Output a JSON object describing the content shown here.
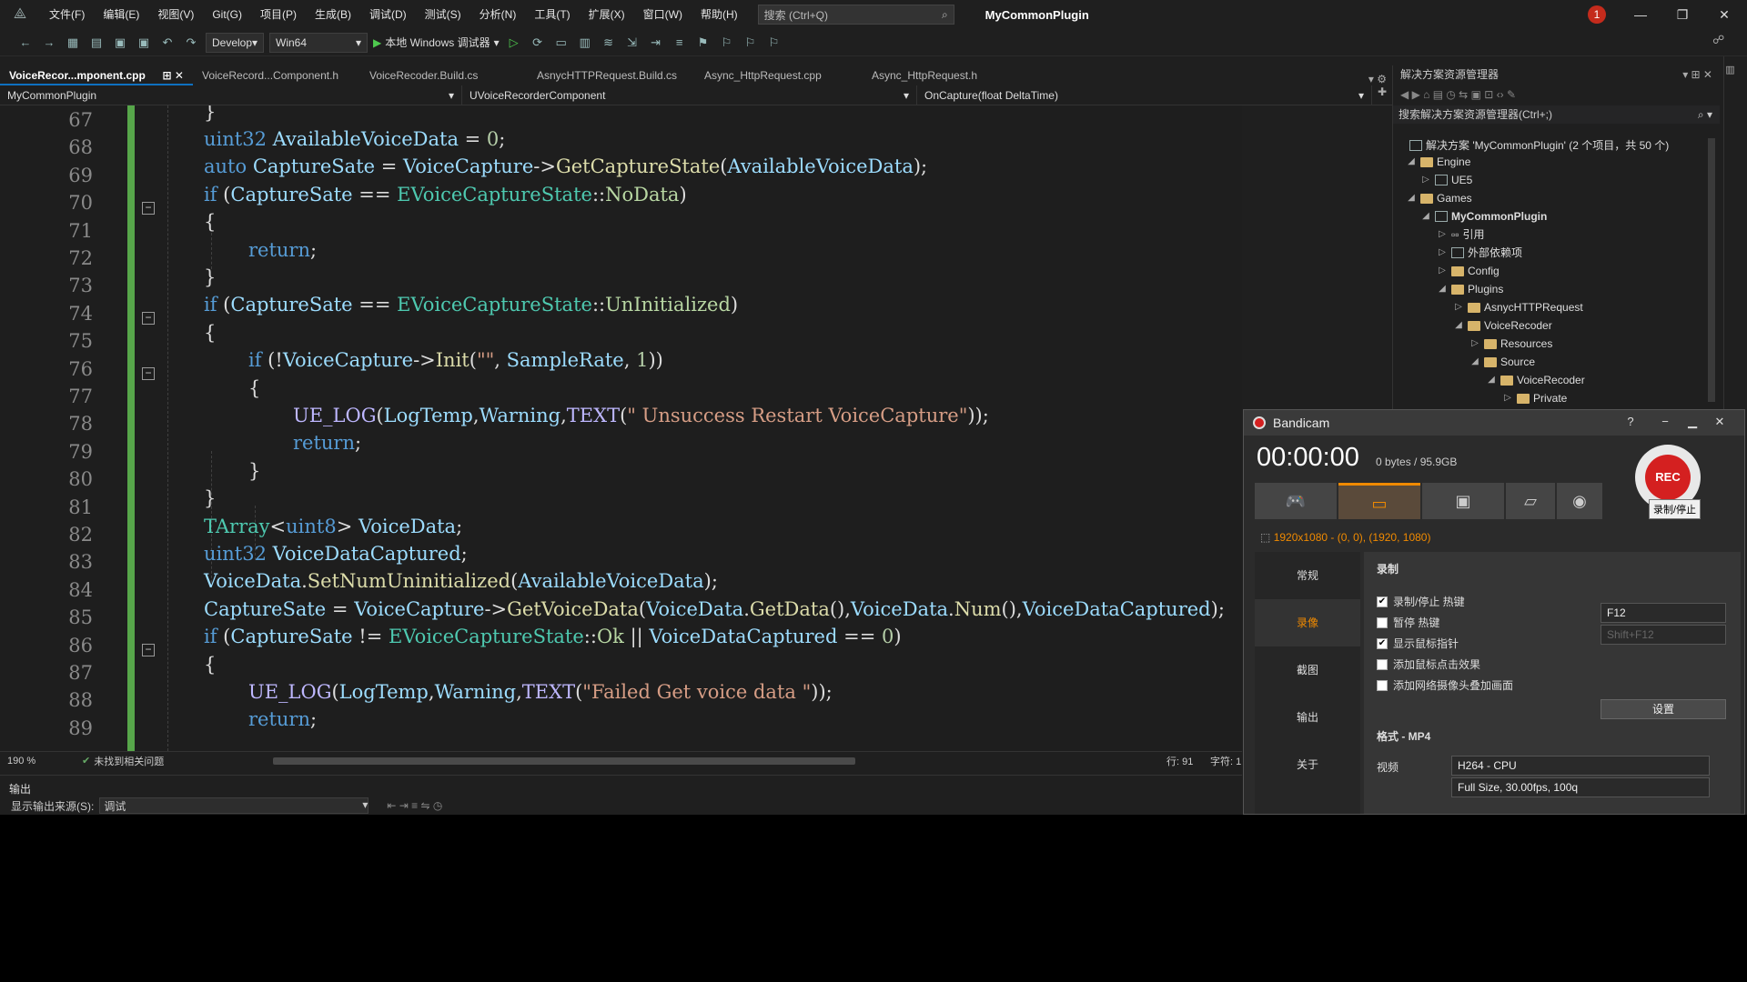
{
  "menu": [
    "文件(F)",
    "编辑(E)",
    "视图(V)",
    "Git(G)",
    "项目(P)",
    "生成(B)",
    "调试(D)",
    "测试(S)",
    "分析(N)",
    "工具(T)",
    "扩展(X)",
    "窗口(W)",
    "帮助(H)"
  ],
  "search": {
    "placeholder": "搜索 (Ctrl+Q)"
  },
  "app_title": "MyCommonPlugin",
  "notification_count": "1",
  "toolbar": {
    "config": "Develop",
    "platform": "Win64",
    "run_label": "本地 Windows 调试器"
  },
  "tabs": [
    "VoiceRecor...mponent.cpp",
    "VoiceRecord...Component.h",
    "VoiceRecoder.Build.cs",
    "AsnycHTTPRequest.Build.cs",
    "Async_HttpRequest.cpp",
    "Async_HttpRequest.h"
  ],
  "nav": {
    "project": "MyCommonPlugin",
    "class": "UVoiceRecorderComponent",
    "method": "OnCapture(float DeltaTime)"
  },
  "line_numbers": [
    "67",
    "68",
    "69",
    "70",
    "71",
    "72",
    "73",
    "74",
    "75",
    "76",
    "77",
    "78",
    "79",
    "80",
    "81",
    "82",
    "83",
    "84",
    "85",
    "86",
    "87",
    "88",
    "89"
  ],
  "editor_status": {
    "zoom": "190 %",
    "issues": "未找到相关问题",
    "line": "行: 91",
    "char": "字符: 1"
  },
  "output": {
    "title": "输出",
    "source_label": "显示输出来源(S):",
    "source_value": "调试"
  },
  "solution_explorer": {
    "title": "解决方案资源管理器",
    "search_placeholder": "搜索解决方案资源管理器(Ctrl+;)",
    "items": [
      "解决方案 'MyCommonPlugin' (2 个项目，共 50 个)",
      "Engine",
      "UE5",
      "Games",
      "MyCommonPlugin",
      "引用",
      "外部依赖项",
      "Config",
      "Plugins",
      "AsnycHTTPRequest",
      "VoiceRecoder",
      "Resources",
      "Source",
      "VoiceRecoder",
      "Private"
    ]
  },
  "bandicam": {
    "title": "Bandicam",
    "timer": "00:00:00",
    "size": "0 bytes / 95.9GB",
    "rec_label": "REC",
    "rec_tooltip": "录制/停止",
    "resolution": "1920x1080 - (0, 0), (1920, 1080)",
    "nav": [
      "常规",
      "录像",
      "截图",
      "输出",
      "关于"
    ],
    "section_title": "录制",
    "checks": [
      {
        "label": "录制/停止 热键",
        "checked": true
      },
      {
        "label": "暂停 热键",
        "checked": false
      },
      {
        "label": "显示鼠标指针",
        "checked": true
      },
      {
        "label": "添加鼠标点击效果",
        "checked": false
      },
      {
        "label": "添加网络摄像头叠加画面",
        "checked": false
      }
    ],
    "hotkey_record": "F12",
    "hotkey_pause": "Shift+F12",
    "settings_button": "设置",
    "format_label": "格式 - MP4",
    "video_label": "视频",
    "video_codec": "H264 - CPU",
    "video_quality": "Full Size, 30.00fps, 100q"
  }
}
